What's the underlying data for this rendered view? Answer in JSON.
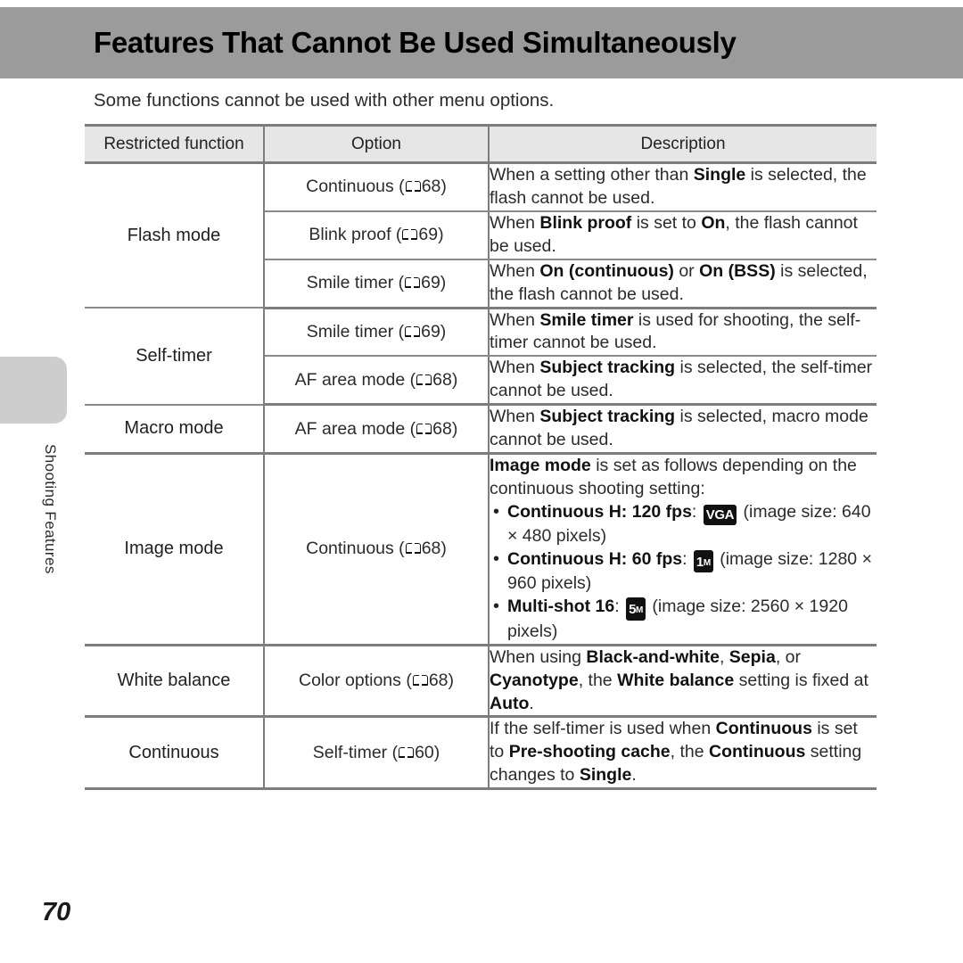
{
  "document": {
    "title": "Features That Cannot Be Used Simultaneously",
    "intro": "Some functions cannot be used with other menu options.",
    "chapter_tab_label": "Shooting Features",
    "page_number": "70"
  },
  "colors": {
    "banner": "#9b9b9b",
    "tab": "#cdcdcd",
    "table_header_bg": "#e6e6e6",
    "rule": "#7d7d7d",
    "badge_bg": "#111111"
  },
  "table": {
    "headers": {
      "restricted_function": "Restricted function",
      "option": "Option",
      "description": "Description"
    },
    "groups": [
      {
        "function": "Flash mode",
        "rows": [
          {
            "option_name": "Continuous",
            "option_page": "68",
            "description_parts": [
              {
                "t": "When a setting other than ",
                "b": false
              },
              {
                "t": "Single",
                "b": true
              },
              {
                "t": " is selected, the flash cannot be used.",
                "b": false
              }
            ]
          },
          {
            "option_name": "Blink proof",
            "option_page": "69",
            "description_parts": [
              {
                "t": "When ",
                "b": false
              },
              {
                "t": "Blink proof",
                "b": true
              },
              {
                "t": " is set to ",
                "b": false
              },
              {
                "t": "On",
                "b": true
              },
              {
                "t": ", the flash cannot be used.",
                "b": false
              }
            ]
          },
          {
            "option_name": "Smile timer",
            "option_page": "69",
            "description_parts": [
              {
                "t": "When ",
                "b": false
              },
              {
                "t": "On (continuous)",
                "b": true
              },
              {
                "t": " or ",
                "b": false
              },
              {
                "t": "On (BSS)",
                "b": true
              },
              {
                "t": " is selected, the flash cannot be used.",
                "b": false
              }
            ]
          }
        ]
      },
      {
        "function": "Self-timer",
        "rows": [
          {
            "option_name": "Smile timer",
            "option_page": "69",
            "description_parts": [
              {
                "t": "When ",
                "b": false
              },
              {
                "t": "Smile timer",
                "b": true
              },
              {
                "t": " is used for shooting, the self-timer cannot be used.",
                "b": false
              }
            ]
          },
          {
            "option_name": "AF area mode",
            "option_page": "68",
            "description_parts": [
              {
                "t": "When ",
                "b": false
              },
              {
                "t": "Subject tracking",
                "b": true
              },
              {
                "t": " is selected, the self-timer cannot be used.",
                "b": false
              }
            ]
          }
        ]
      },
      {
        "function": "Macro mode",
        "rows": [
          {
            "option_name": "AF area mode",
            "option_page": "68",
            "description_parts": [
              {
                "t": "When ",
                "b": false
              },
              {
                "t": "Subject tracking",
                "b": true
              },
              {
                "t": " is selected, macro mode cannot be used.",
                "b": false
              }
            ]
          }
        ]
      },
      {
        "function": "Image mode",
        "rows": [
          {
            "option_name": "Continuous",
            "option_page": "68",
            "description_lead": [
              {
                "t": "Image mode",
                "b": true
              },
              {
                "t": " is set as follows depending on the continuous shooting setting:",
                "b": false
              }
            ],
            "bullets": [
              {
                "label": "Continuous H: 120 fps",
                "badge_big": "",
                "badge_small": "VGA",
                "badge_kind": "vga",
                "tail": "(image size: 640 × 480 pixels)"
              },
              {
                "label": "Continuous H: 60 fps",
                "badge_big": "1",
                "badge_small": "M",
                "badge_kind": "mp",
                "tail": "(image size: 1280 × 960 pixels)"
              },
              {
                "label": "Multi-shot 16",
                "badge_big": "5",
                "badge_small": "M",
                "badge_kind": "mp",
                "tail": "(image size: 2560 × 1920 pixels)"
              }
            ]
          }
        ]
      },
      {
        "function": "White balance",
        "rows": [
          {
            "option_name": "Color options",
            "option_page": "68",
            "description_parts": [
              {
                "t": "When using ",
                "b": false
              },
              {
                "t": "Black-and-white",
                "b": true
              },
              {
                "t": ", ",
                "b": false
              },
              {
                "t": "Sepia",
                "b": true
              },
              {
                "t": ", or ",
                "b": false
              },
              {
                "t": "Cyanotype",
                "b": true
              },
              {
                "t": ", the ",
                "b": false
              },
              {
                "t": "White balance",
                "b": true
              },
              {
                "t": " setting is fixed at ",
                "b": false
              },
              {
                "t": "Auto",
                "b": true
              },
              {
                "t": ".",
                "b": false
              }
            ]
          }
        ]
      },
      {
        "function": "Continuous",
        "rows": [
          {
            "option_name": "Self-timer",
            "option_page": "60",
            "description_parts": [
              {
                "t": "If the self-timer is used when ",
                "b": false
              },
              {
                "t": "Continuous",
                "b": true
              },
              {
                "t": " is set to ",
                "b": false
              },
              {
                "t": "Pre-shooting cache",
                "b": true
              },
              {
                "t": ", the ",
                "b": false
              },
              {
                "t": "Continuous",
                "b": true
              },
              {
                "t": " setting changes to ",
                "b": false
              },
              {
                "t": "Single",
                "b": true
              },
              {
                "t": ".",
                "b": false
              }
            ]
          }
        ]
      }
    ]
  }
}
